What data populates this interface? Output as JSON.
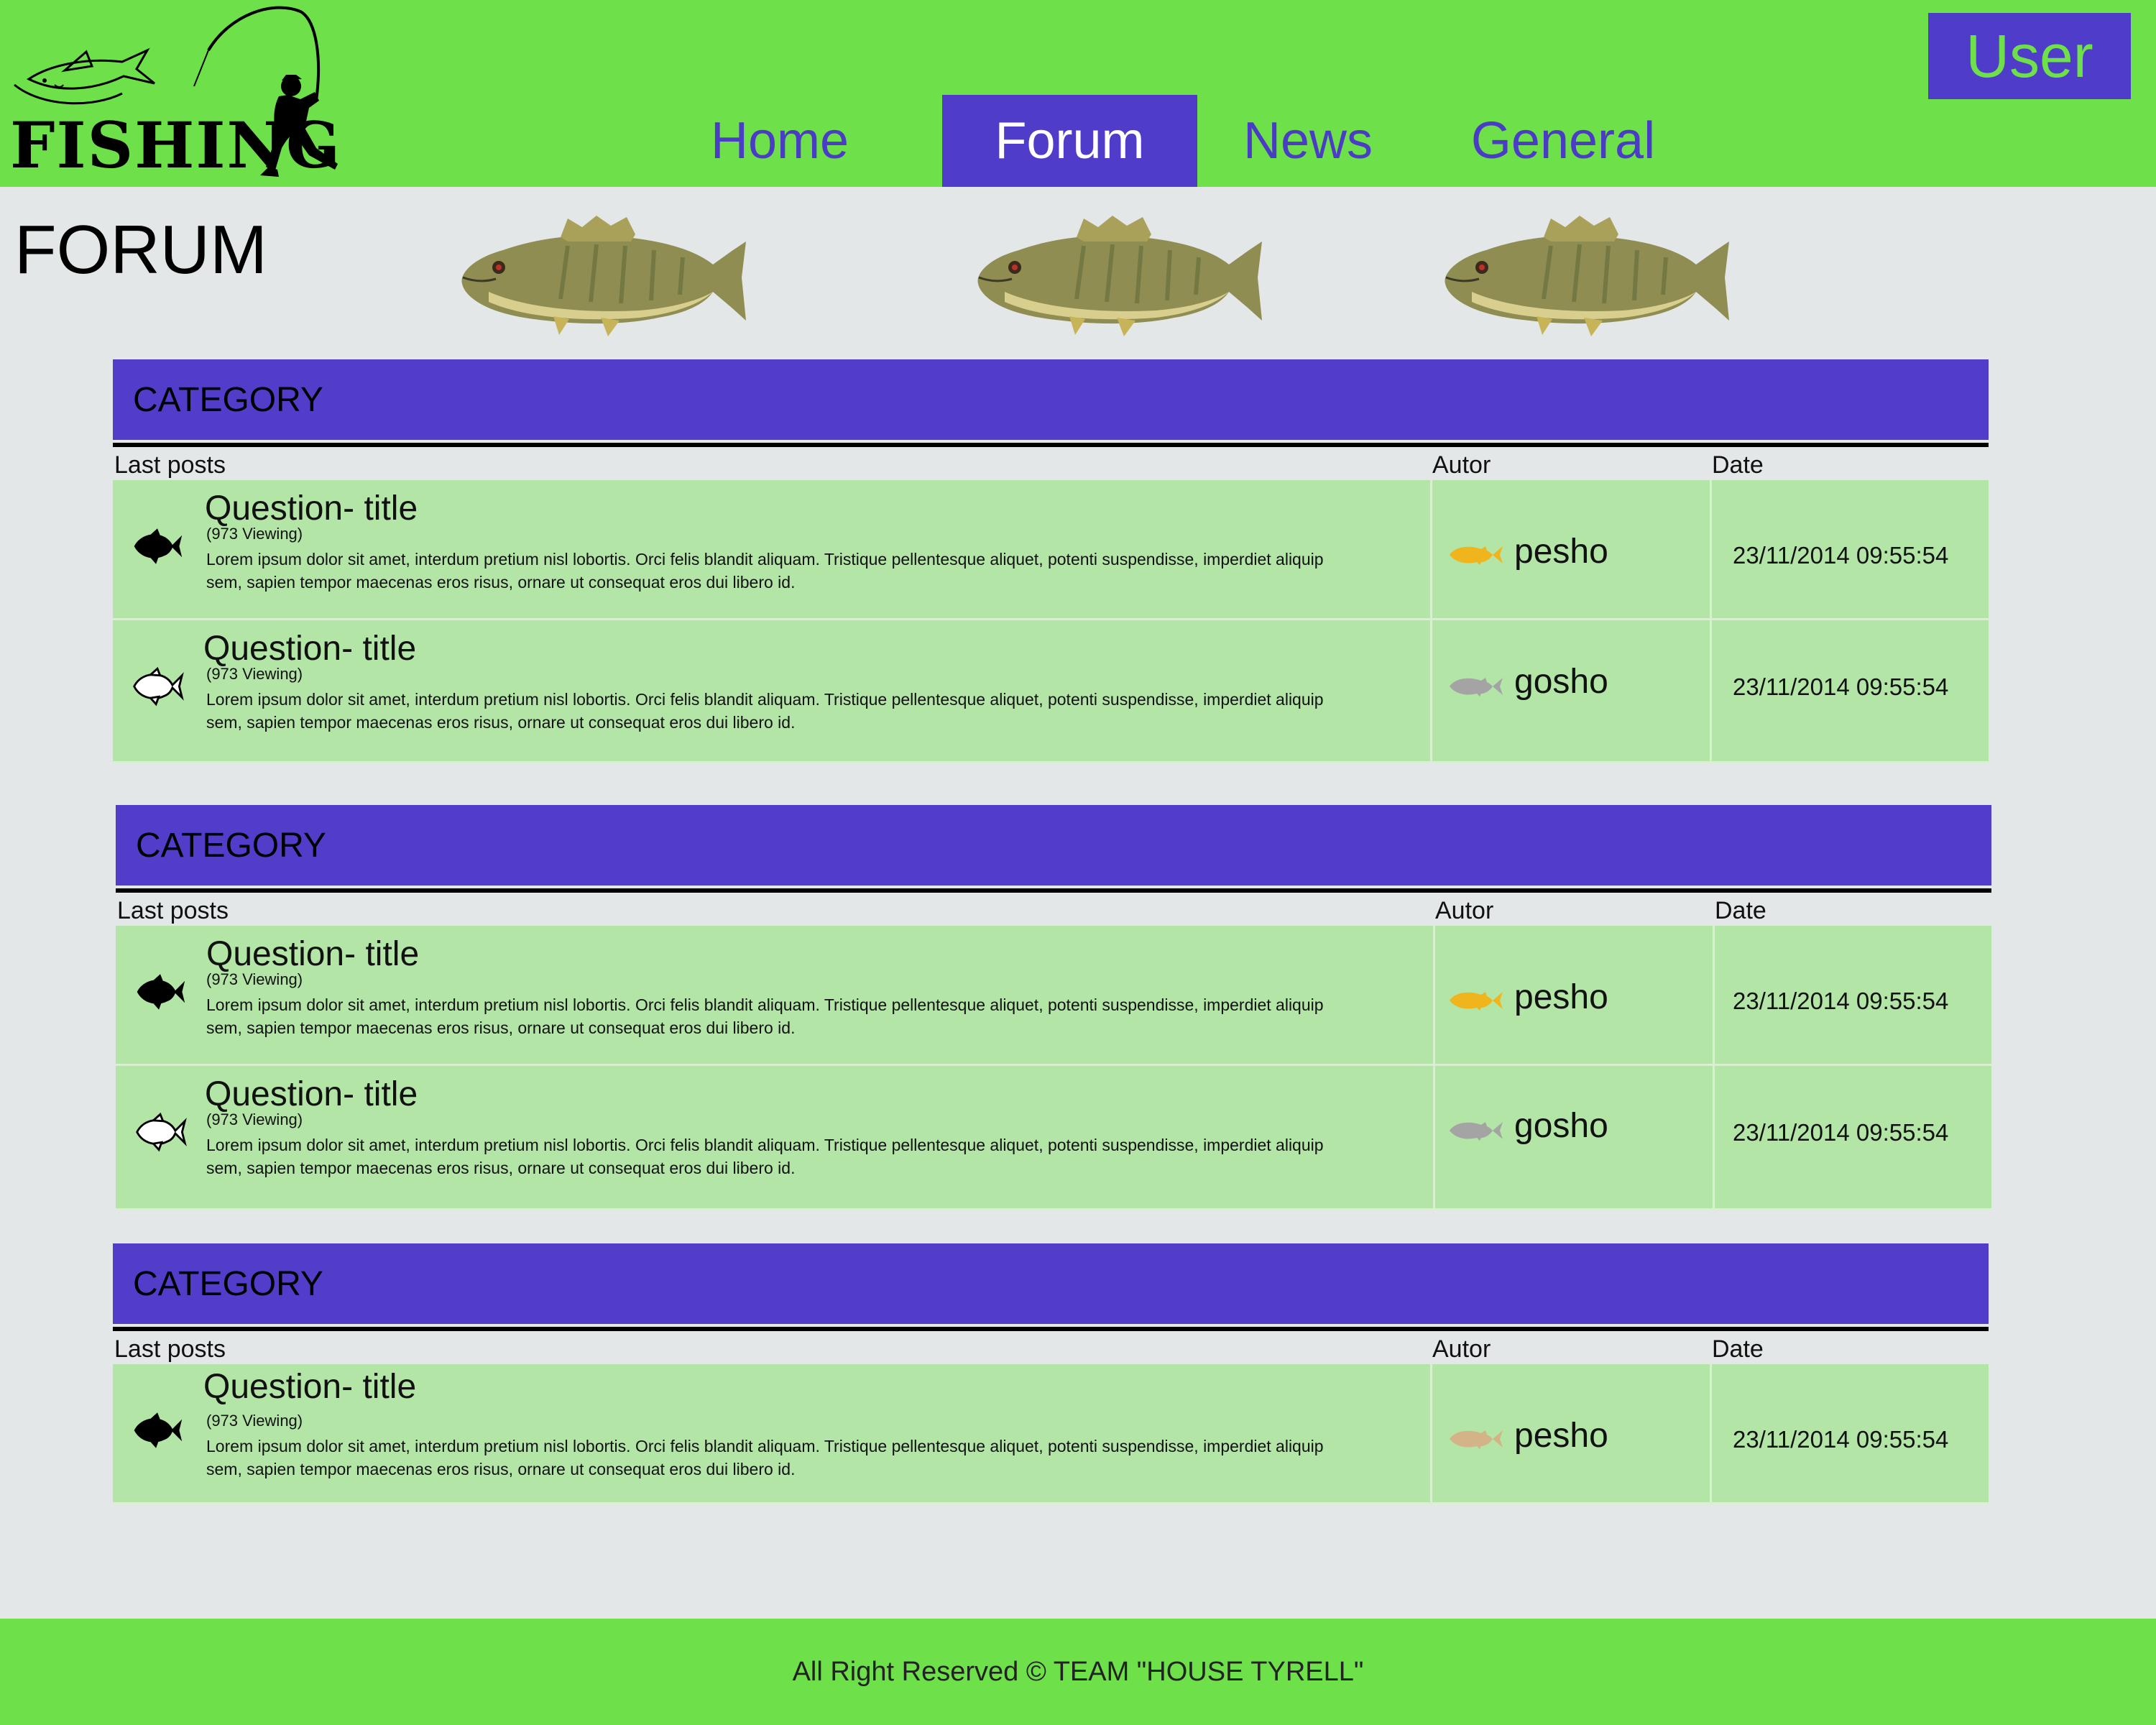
{
  "header": {
    "logo_text": "FISHING",
    "nav": [
      {
        "label": "Home",
        "active": false
      },
      {
        "label": "Forum",
        "active": true
      },
      {
        "label": "News",
        "active": false
      },
      {
        "label": "General",
        "active": false
      }
    ],
    "user_label": "User"
  },
  "page": {
    "title": "FORUM"
  },
  "colors": {
    "header_green": "#6de04a",
    "accent_purple": "#523dca",
    "row_green": "#b3e5a6",
    "background": "#e3e7e8",
    "author_gold": "#f0b51c",
    "author_gray": "#a4a4a4",
    "author_tan": "#d2b488"
  },
  "sections": [
    {
      "category": "CATEGORY",
      "columns": {
        "posts": "Last posts",
        "author": "Autor",
        "date": "Date"
      },
      "rows": [
        {
          "status_icon": "fish-filled-icon",
          "title": "Question- title",
          "views": "(973 Viewing)",
          "body": "Lorem ipsum dolor sit amet, interdum pretium nisl lobortis. Orci felis blandit aliquam. Tristique pellentesque aliquet, potenti suspendisse, imperdiet aliquip sem, sapien tempor maecenas eros risus, ornare ut consequat eros dui libero id.",
          "author": "pesho",
          "author_icon": "gold-fish-icon",
          "date": "23/11/2014 09:55:54"
        },
        {
          "status_icon": "fish-outline-icon",
          "title": "Question- title",
          "views": "(973 Viewing)",
          "body": "Lorem ipsum dolor sit amet, interdum pretium nisl lobortis. Orci felis blandit aliquam. Tristique pellentesque aliquet, potenti suspendisse, imperdiet aliquip sem, sapien tempor maecenas eros risus, ornare ut consequat eros dui libero id.",
          "author": "gosho",
          "author_icon": "gray-fish-icon",
          "date": "23/11/2014 09:55:54"
        }
      ]
    },
    {
      "category": "CATEGORY",
      "columns": {
        "posts": "Last posts",
        "author": "Autor",
        "date": "Date"
      },
      "rows": [
        {
          "status_icon": "fish-filled-icon",
          "title": "Question- title",
          "views": "(973 Viewing)",
          "body": "Lorem ipsum dolor sit amet, interdum pretium nisl lobortis. Orci felis blandit aliquam. Tristique pellentesque aliquet, potenti suspendisse, imperdiet aliquip sem, sapien tempor maecenas eros risus, ornare ut consequat eros dui libero id.",
          "author": "pesho",
          "author_icon": "gold-fish-icon",
          "date": "23/11/2014 09:55:54"
        },
        {
          "status_icon": "fish-outline-icon",
          "title": "Question- title",
          "views": "(973 Viewing)",
          "body": "Lorem ipsum dolor sit amet, interdum pretium nisl lobortis. Orci felis blandit aliquam. Tristique pellentesque aliquet, potenti suspendisse, imperdiet aliquip sem, sapien tempor maecenas eros risus, ornare ut consequat eros dui libero id.",
          "author": "gosho",
          "author_icon": "gray-fish-icon",
          "date": "23/11/2014 09:55:54"
        }
      ]
    },
    {
      "category": "CATEGORY",
      "columns": {
        "posts": "Last posts",
        "author": "Autor",
        "date": "Date"
      },
      "rows": [
        {
          "status_icon": "fish-filled-icon",
          "title": "Question- title",
          "views": "(973 Viewing)",
          "body": "Lorem ipsum dolor sit amet, interdum pretium nisl lobortis. Orci felis blandit aliquam. Tristique pellentesque aliquet, potenti suspendisse, imperdiet aliquip sem, sapien tempor maecenas eros risus, ornare ut consequat eros dui libero id.",
          "author": "pesho",
          "author_icon": "tan-fish-icon",
          "date": "23/11/2014 09:55:54"
        }
      ]
    }
  ],
  "footer": {
    "text": "All Right Reserved © TEAM \"HOUSE TYRELL\""
  }
}
